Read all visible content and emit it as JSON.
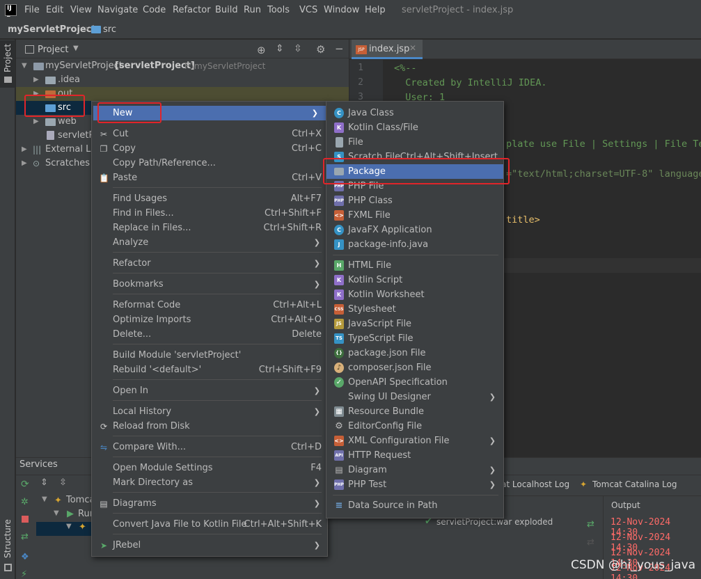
{
  "menubar": {
    "items": [
      "File",
      "Edit",
      "View",
      "Navigate",
      "Code",
      "Refactor",
      "Build",
      "Run",
      "Tools",
      "VCS",
      "Window",
      "Help"
    ],
    "window_title": "servletProject - index.jsp"
  },
  "breadcrumb": {
    "project": "myServletProject",
    "folder": "src"
  },
  "left_strip": {
    "project_tab": "Project",
    "structure_tab": "Structure"
  },
  "project_panel": {
    "header": "Project",
    "root_name": "myServletProject",
    "root_module": "[servletProject]",
    "root_path": "F:\\myServletProject",
    "rows": [
      ".idea",
      "out",
      "src",
      "web",
      "servletP",
      "External Lib",
      "Scratches a"
    ]
  },
  "editor": {
    "tab_label": "index.jsp",
    "tab_icon": "JSP",
    "line_numbers": [
      "1",
      "2",
      "3"
    ],
    "lines": [
      "<%--",
      "  Created by IntelliJ IDEA.",
      "  User: 1",
      "plate use File | Settings | File Te",
      "=\"text/html;charset=UTF-8\" language",
      "title>"
    ]
  },
  "services": {
    "title": "Services",
    "tree": [
      "Tomca",
      "Run"
    ],
    "tabs": [
      "at Localhost Log",
      "Tomcat Catalina Log"
    ],
    "output_header": "Output",
    "deploy_item": "servletProject:war exploded",
    "log_lines": [
      "12-Nov-2024 14:30",
      "12-Nov-2024 14:30",
      "12-Nov-2024 14:30",
      "12-Nov-2024 14:30"
    ],
    "log_color": "#ff6b68"
  },
  "context_menu": {
    "items": [
      {
        "label": "New",
        "shortcut": "",
        "submenu": true
      },
      {
        "label": "Cut",
        "shortcut": "Ctrl+X"
      },
      {
        "label": "Copy",
        "shortcut": "Ctrl+C"
      },
      {
        "label": "Copy Path/Reference...",
        "shortcut": ""
      },
      {
        "label": "Paste",
        "shortcut": "Ctrl+V"
      },
      {
        "label": "Find Usages",
        "shortcut": "Alt+F7"
      },
      {
        "label": "Find in Files...",
        "shortcut": "Ctrl+Shift+F"
      },
      {
        "label": "Replace in Files...",
        "shortcut": "Ctrl+Shift+R"
      },
      {
        "label": "Analyze",
        "shortcut": "",
        "submenu": true
      },
      {
        "label": "Refactor",
        "shortcut": "",
        "submenu": true
      },
      {
        "label": "Bookmarks",
        "shortcut": "",
        "submenu": true
      },
      {
        "label": "Reformat Code",
        "shortcut": "Ctrl+Alt+L"
      },
      {
        "label": "Optimize Imports",
        "shortcut": "Ctrl+Alt+O"
      },
      {
        "label": "Delete...",
        "shortcut": "Delete"
      },
      {
        "label": "Build Module 'servletProject'",
        "shortcut": ""
      },
      {
        "label": "Rebuild '<default>'",
        "shortcut": "Ctrl+Shift+F9"
      },
      {
        "label": "Open In",
        "shortcut": "",
        "submenu": true
      },
      {
        "label": "Local History",
        "shortcut": "",
        "submenu": true
      },
      {
        "label": "Reload from Disk",
        "shortcut": ""
      },
      {
        "label": "Compare With...",
        "shortcut": "Ctrl+D"
      },
      {
        "label": "Open Module Settings",
        "shortcut": "F4"
      },
      {
        "label": "Mark Directory as",
        "shortcut": "",
        "submenu": true
      },
      {
        "label": "Diagrams",
        "shortcut": "",
        "submenu": true
      },
      {
        "label": "Convert Java File to Kotlin File",
        "shortcut": "Ctrl+Alt+Shift+K"
      },
      {
        "label": "JRebel",
        "shortcut": "",
        "submenu": true
      }
    ]
  },
  "submenu": {
    "items": [
      {
        "label": "Java Class",
        "icon": "C"
      },
      {
        "label": "Kotlin Class/File",
        "icon": "K"
      },
      {
        "label": "File",
        "icon": ""
      },
      {
        "label": "Scratch File",
        "shortcut": "Ctrl+Alt+Shift+Insert",
        "icon": "S"
      },
      {
        "label": "Package",
        "icon": ""
      },
      {
        "label": "PHP File",
        "icon": "PHP"
      },
      {
        "label": "PHP Class",
        "icon": "PHP"
      },
      {
        "label": "FXML File",
        "icon": "<>"
      },
      {
        "label": "JavaFX Application",
        "icon": "C"
      },
      {
        "label": "package-info.java",
        "icon": "J"
      },
      {
        "label": "HTML File",
        "icon": "H"
      },
      {
        "label": "Kotlin Script",
        "icon": "K"
      },
      {
        "label": "Kotlin Worksheet",
        "icon": "K"
      },
      {
        "label": "Stylesheet",
        "icon": "CSS"
      },
      {
        "label": "JavaScript File",
        "icon": "JS"
      },
      {
        "label": "TypeScript File",
        "icon": "TS"
      },
      {
        "label": "package.json File",
        "icon": "{}"
      },
      {
        "label": "composer.json File",
        "icon": "♪"
      },
      {
        "label": "OpenAPI Specification",
        "icon": "✓"
      },
      {
        "label": "Swing UI Designer",
        "icon": "",
        "submenu": true
      },
      {
        "label": "Resource Bundle",
        "icon": "▦"
      },
      {
        "label": "EditorConfig File",
        "icon": "⚙"
      },
      {
        "label": "XML Configuration File",
        "icon": "<>",
        "submenu": true
      },
      {
        "label": "HTTP Request",
        "icon": "API"
      },
      {
        "label": "Diagram",
        "icon": "▤",
        "submenu": true
      },
      {
        "label": "PHP Test",
        "icon": "PHP",
        "submenu": true
      },
      {
        "label": "Data Source in Path",
        "icon": "≡"
      }
    ]
  },
  "watermark": "CSDN @hi_yous_java",
  "colors": {
    "accent": "#4b6eaf",
    "highlight_box": "#e0252a",
    "folder_blue": "#5d9fd6",
    "folder_orange": "#c06a3a"
  }
}
